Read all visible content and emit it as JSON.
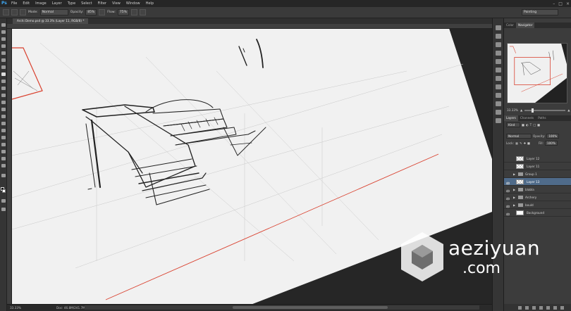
{
  "app": {
    "logo": "Ps",
    "menu": [
      "File",
      "Edit",
      "Image",
      "Layer",
      "Type",
      "Select",
      "Filter",
      "View",
      "Window",
      "Help"
    ]
  },
  "options": {
    "mode_label": "Mode:",
    "mode_value": "Normal",
    "opacity_label": "Opacity:",
    "opacity_value": "85%",
    "flow_label": "Flow:",
    "flow_value": "75%",
    "workspace": "Painting"
  },
  "document": {
    "tab_title": "Archi Demo.psd @ 33.3% (Layer 11, RGB/8) *",
    "zoom": "33.33%",
    "doc_size": "Doc: 46.8M/241.7M"
  },
  "navigator": {
    "tabs": [
      "Color",
      "Navigator"
    ],
    "active_tab": "Navigator",
    "zoom": "33.33%"
  },
  "layers_panel": {
    "tabs": [
      "Layers",
      "Channels",
      "Paths"
    ],
    "active_tab": "Layers",
    "filter_label": "Kind",
    "blend_mode": "Normal",
    "opacity_label": "Opacity:",
    "opacity_value": "100%",
    "lock_label": "Lock:",
    "fill_label": "Fill:",
    "fill_value": "100%",
    "layers": [
      {
        "name": "Layer 12",
        "type": "layer",
        "visible": false,
        "selected": false
      },
      {
        "name": "Layer 11",
        "type": "layer",
        "visible": false,
        "selected": false
      },
      {
        "name": "Group 1",
        "type": "group",
        "visible": false,
        "selected": false
      },
      {
        "name": "Layer 13",
        "type": "layer",
        "visible": true,
        "selected": true
      },
      {
        "name": "blabla",
        "type": "group",
        "visible": true,
        "selected": false
      },
      {
        "name": "Archery",
        "type": "group",
        "visible": true,
        "selected": false
      },
      {
        "name": "bould",
        "type": "group",
        "visible": true,
        "selected": false
      },
      {
        "name": "Background",
        "type": "background",
        "visible": true,
        "selected": false
      }
    ]
  },
  "watermark": {
    "text": "aeziyuan",
    "sub": ".com"
  },
  "colors": {
    "canvas_paper": "#f1f1f1",
    "stroke": "#222222",
    "accent_red": "#d9402e",
    "selected_layer": "#4f6b8a"
  }
}
